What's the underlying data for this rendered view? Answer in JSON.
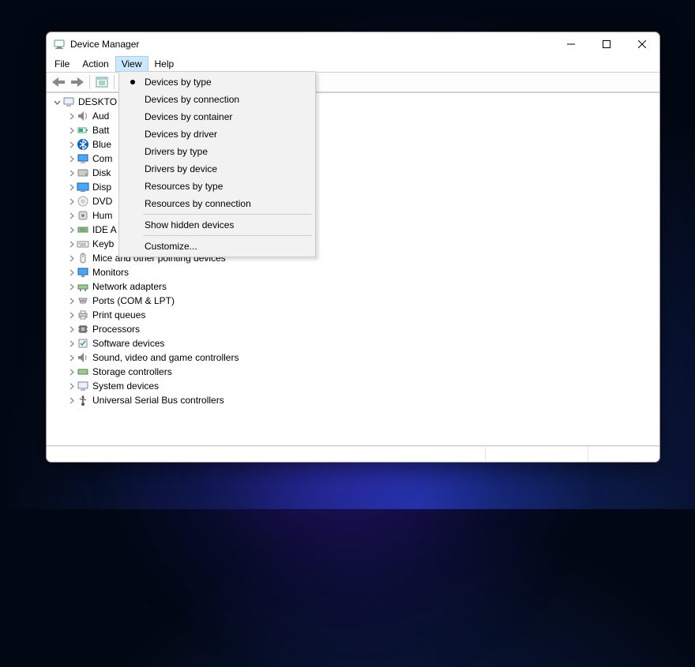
{
  "window": {
    "title": "Device Manager"
  },
  "menubar": {
    "items": [
      {
        "label": "File"
      },
      {
        "label": "Action"
      },
      {
        "label": "View",
        "active": true
      },
      {
        "label": "Help"
      }
    ]
  },
  "toolbar": {
    "back": "back-icon",
    "forward": "forward-icon",
    "properties": "properties-icon",
    "help": "help-icon"
  },
  "tree": {
    "root": {
      "label": "DESKTO"
    },
    "nodes": [
      {
        "label": "Aud",
        "icon": "audio-icon"
      },
      {
        "label": "Batt",
        "icon": "battery-icon"
      },
      {
        "label": "Blue",
        "icon": "bluetooth-icon"
      },
      {
        "label": "Com",
        "icon": "computer-icon"
      },
      {
        "label": "Disk",
        "icon": "disk-icon"
      },
      {
        "label": "Disp",
        "icon": "display-icon"
      },
      {
        "label": "DVD",
        "icon": "dvd-icon"
      },
      {
        "label": "Hum",
        "icon": "hid-icon"
      },
      {
        "label": "IDE A",
        "icon": "ide-icon"
      },
      {
        "label": "Keyb",
        "icon": "keyboard-icon"
      },
      {
        "label": "Mice and other pointing devices",
        "icon": "mouse-icon"
      },
      {
        "label": "Monitors",
        "icon": "monitor-icon"
      },
      {
        "label": "Network adapters",
        "icon": "network-icon"
      },
      {
        "label": "Ports (COM & LPT)",
        "icon": "port-icon"
      },
      {
        "label": "Print queues",
        "icon": "printer-icon"
      },
      {
        "label": "Processors",
        "icon": "processor-icon"
      },
      {
        "label": "Software devices",
        "icon": "software-icon"
      },
      {
        "label": "Sound, video and game controllers",
        "icon": "sound-icon"
      },
      {
        "label": "Storage controllers",
        "icon": "storage-icon"
      },
      {
        "label": "System devices",
        "icon": "system-icon"
      },
      {
        "label": "Universal Serial Bus controllers",
        "icon": "usb-icon"
      }
    ]
  },
  "dropdown": {
    "items": [
      {
        "label": "Devices by type",
        "selected": true
      },
      {
        "label": "Devices by connection"
      },
      {
        "label": "Devices by container"
      },
      {
        "label": "Devices by driver"
      },
      {
        "label": "Drivers by type"
      },
      {
        "label": "Drivers by device"
      },
      {
        "label": "Resources by type"
      },
      {
        "label": "Resources by connection"
      }
    ],
    "hidden": {
      "label": "Show hidden devices"
    },
    "customize": {
      "label": "Customize..."
    }
  }
}
